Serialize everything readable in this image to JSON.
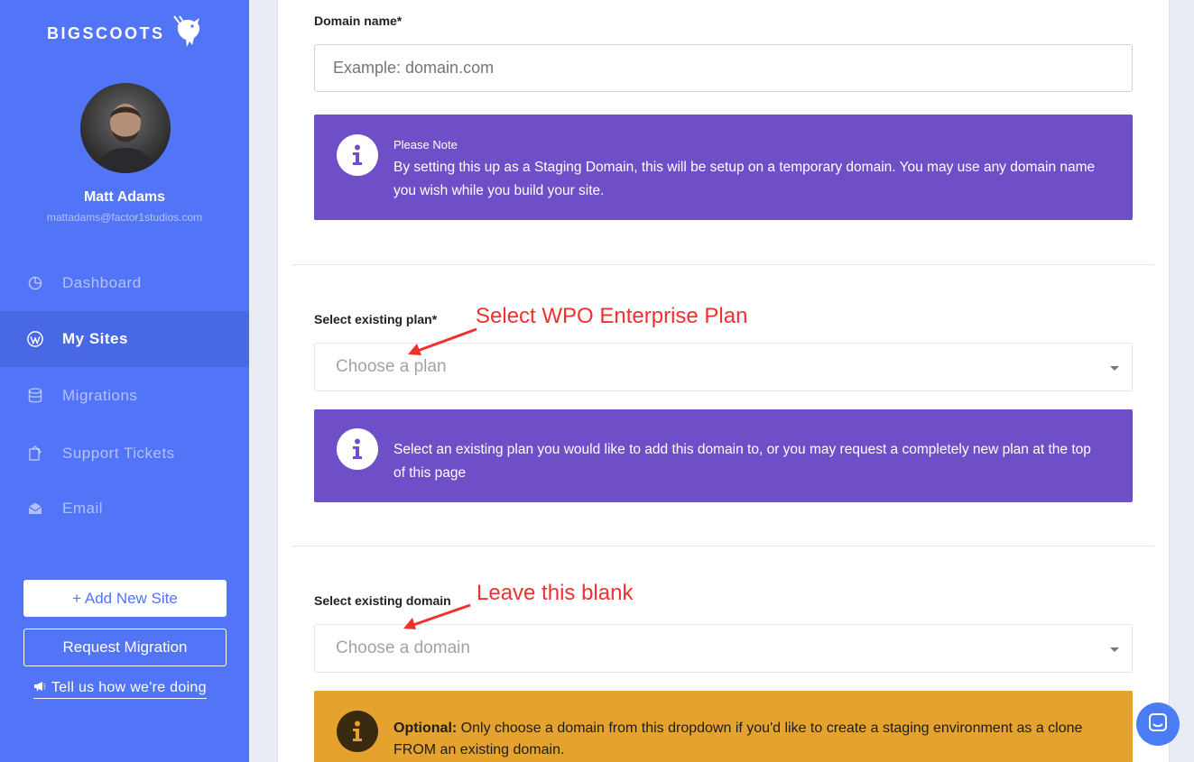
{
  "brand": {
    "name": "BIGSCOOTS"
  },
  "user": {
    "name": "Matt Adams",
    "email": "mattadams@factor1studios.com"
  },
  "nav": [
    {
      "label": "Dashboard",
      "icon": "dashboard-icon",
      "active": false
    },
    {
      "label": "My Sites",
      "icon": "wordpress-icon",
      "active": true
    },
    {
      "label": "Migrations",
      "icon": "database-icon",
      "active": false
    },
    {
      "label": "Support Tickets",
      "icon": "ticket-icon",
      "active": false
    },
    {
      "label": "Email",
      "icon": "envelope-icon",
      "active": false
    }
  ],
  "sidebar_actions": {
    "add_site": "+ Add New Site",
    "request_migration": "Request Migration",
    "feedback": "Tell us how we're doing"
  },
  "form": {
    "domain": {
      "label": "Domain name*",
      "placeholder": "Example: domain.com",
      "note_title": "Please Note",
      "note_text": "By setting this up as a Staging Domain, this will be setup on a temporary domain. You may use any domain name you wish while you build your site."
    },
    "plan": {
      "label": "Select existing plan*",
      "placeholder": "Choose a plan",
      "note_text": "Select an existing plan you would like to add this domain to, or you may request a completely new plan at the top of this page"
    },
    "existing_domain": {
      "label": "Select existing domain",
      "placeholder": "Choose a domain",
      "warn_bold": "Optional:",
      "warn_text": " Only choose a domain from this dropdown if you'd like to create a staging environment as a clone FROM an existing domain."
    }
  },
  "annotations": {
    "plan": "Select WPO Enterprise Plan",
    "domain": "Leave this blank"
  },
  "colors": {
    "sidebar": "#5274f6",
    "note": "#6e4fc8",
    "warning": "#e5a22f",
    "annotation": "#f0312d"
  }
}
